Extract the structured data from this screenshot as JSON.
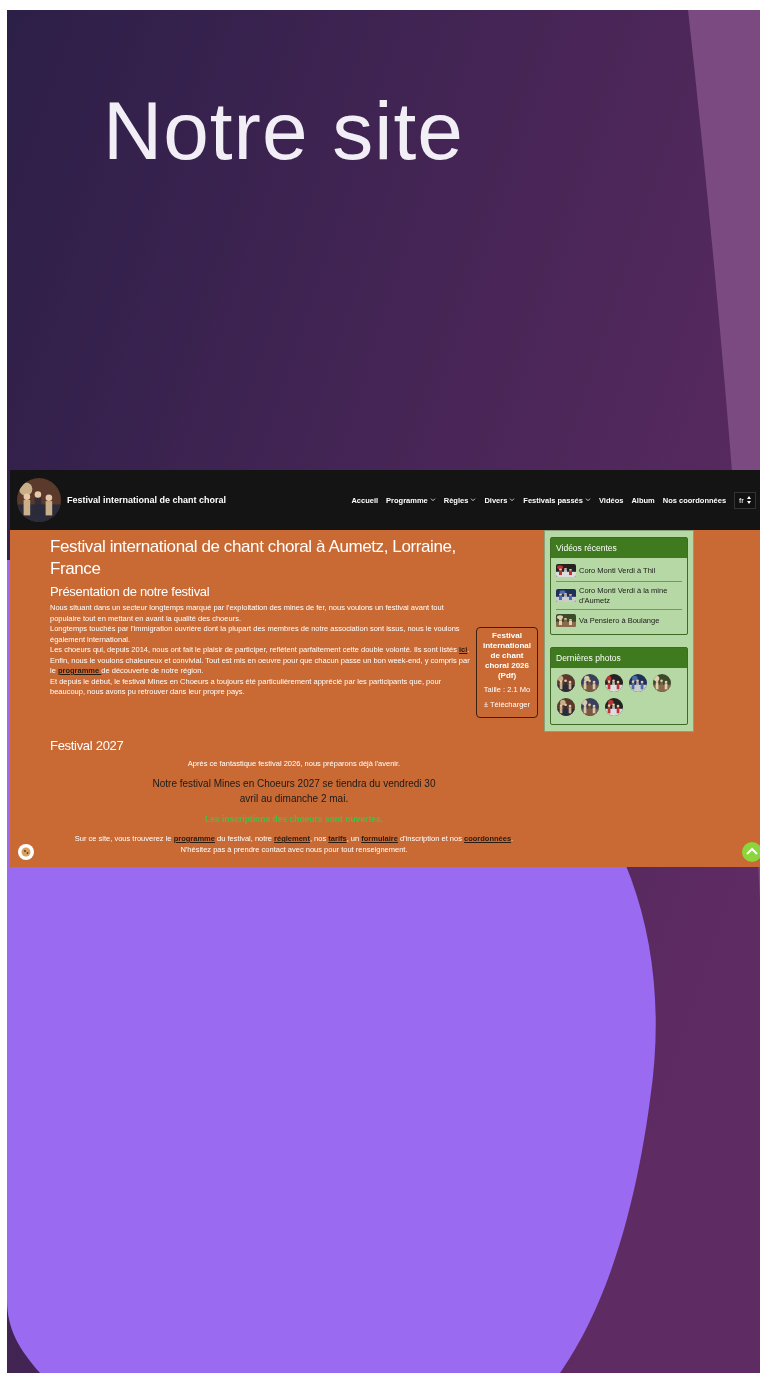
{
  "slide": {
    "title": "Notre site"
  },
  "site": {
    "header": {
      "title": "Festival international de chant choral",
      "nav": [
        {
          "label": "Accueil",
          "has_menu": false
        },
        {
          "label": "Programme",
          "has_menu": true
        },
        {
          "label": "Règles",
          "has_menu": true
        },
        {
          "label": "Divers",
          "has_menu": true
        },
        {
          "label": "Festivals passés",
          "has_menu": true
        },
        {
          "label": "Vidéos",
          "has_menu": false
        },
        {
          "label": "Album",
          "has_menu": false
        },
        {
          "label": "Nos coordonnées",
          "has_menu": false
        }
      ],
      "language": "fr"
    },
    "main": {
      "heading": "Festival international de chant choral à Aumetz, Lorraine, France",
      "subheading": "Présentation de notre festival",
      "paragraphs": [
        [
          {
            "text": "Nous situant dans un secteur longtemps marqué par l'exploitation des mines de fer, nous voulons un festival avant tout populaire tout en mettant en avant la qualité des choeurs.",
            "kind": "text"
          }
        ],
        [
          {
            "text": "Longtemps touchés par l'immigration ouvrière dont la plupart des membres de notre association sont issus, nous le voulons également international.",
            "kind": "text"
          }
        ],
        [
          {
            "text": "Les choeurs qui, depuis 2014, nous ont fait le plaisir de participer, reflètent parfaitement cette double volonté. Ils sont listés ",
            "kind": "text"
          },
          {
            "text": "ici",
            "kind": "link"
          },
          {
            "text": ".",
            "kind": "text"
          }
        ],
        [
          {
            "text": "Enfin, nous le voulons chaleureux et convivial. Tout est mis en oeuvre pour que chacun passe un bon week-end, y compris par le ",
            "kind": "text"
          },
          {
            "text": "programme ",
            "kind": "link"
          },
          {
            "text": "de découverte de notre région.",
            "kind": "text"
          }
        ],
        [
          {
            "text": "Et depuis le début, le festival Mines en Choeurs a toujours été particulièrement apprécié par les participants que, pour beaucoup, nous avons pu retrouver dans leur propre pays.",
            "kind": "text"
          }
        ]
      ]
    },
    "download": {
      "title": "Festival international de chant choral 2026 (Pdf)",
      "size": "Taille : 2.1 Mo",
      "button": "Télécharger"
    },
    "festival": {
      "heading": "Festival 2027",
      "intro": "Après ce fantastique festival 2026, nous préparons déjà l'avenir.",
      "announcement": "Notre festival Mines en Choeurs 2027 se tiendra du vendredi 30 avril au dimanche 2 mai.",
      "registration": "Les inscriptions des choeurs sont ouvertes.",
      "closing": [
        {
          "text": "Sur ce site, vous trouverez le ",
          "kind": "text"
        },
        {
          "text": "programme",
          "kind": "link"
        },
        {
          "text": " du festival, notre ",
          "kind": "text"
        },
        {
          "text": "réglement",
          "kind": "link"
        },
        {
          "text": ", nos ",
          "kind": "text"
        },
        {
          "text": "tarifs",
          "kind": "link"
        },
        {
          "text": ", un ",
          "kind": "text"
        },
        {
          "text": "formulaire",
          "kind": "link"
        },
        {
          "text": " d'inscription et nos ",
          "kind": "text"
        },
        {
          "text": "coordonnées",
          "kind": "link"
        },
        {
          "text": ". N'hésitez pas à prendre contact avec nous pour tout renseignement.",
          "kind": "text"
        }
      ]
    },
    "sidebar": {
      "videos": {
        "title": "Vidéos récentes",
        "items": [
          {
            "title": "Coro Monti Verdi à Thil"
          },
          {
            "title": "Coro Monti Verdi à la mine d'Aumetz"
          },
          {
            "title": "Va Pensiero à Boulange"
          }
        ]
      },
      "photos": {
        "title": "Dernières photos"
      }
    }
  }
}
